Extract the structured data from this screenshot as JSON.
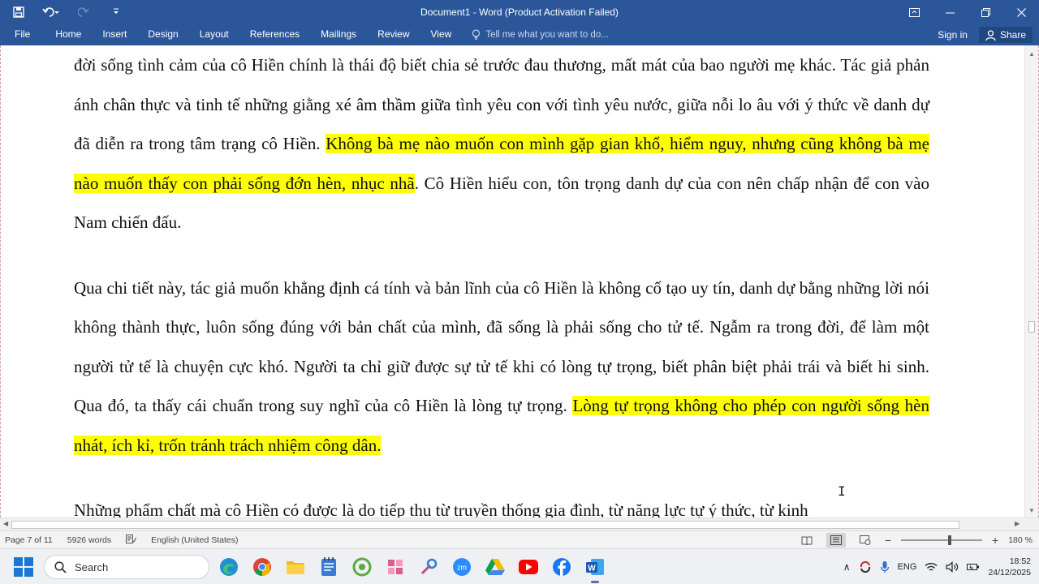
{
  "window": {
    "title": "Document1 - Word (Product Activation Failed)"
  },
  "ribbon": {
    "tabs": [
      "File",
      "Home",
      "Insert",
      "Design",
      "Layout",
      "References",
      "Mailings",
      "Review",
      "View"
    ],
    "tell_me_placeholder": "Tell me what you want to do...",
    "sign_in": "Sign in",
    "share": "Share"
  },
  "document": {
    "paragraphs": [
      {
        "segments": [
          {
            "text": "đời sống tình cảm của cô Hiền chính là thái độ biết chia sẻ trước đau thương, mất mát của bao người mẹ khác. Tác giả phản ánh chân thực và tinh tế những giằng xé âm thầm giữa tình yêu con với tình yêu nước, giữa nỗi lo âu với ý thức về danh dự đã diễn ra trong tâm trạng cô Hiền. ",
            "highlight": false
          },
          {
            "text": "Không bà mẹ nào muốn con mình gặp gian khổ, hiểm nguy, nhưng cũng không bà mẹ nào muốn thấy con phải sống đớn hèn, nhục nhã",
            "highlight": true
          },
          {
            "text": ". Cô Hiền hiểu con, tôn trọng danh dự của con nên chấp nhận để con vào Nam chiến đấu.",
            "highlight": false
          }
        ]
      },
      {
        "segments": [
          {
            "text": "Qua chi tiết này, tác giả muốn khẳng định cá tính và bản lĩnh của cô Hiền là không cố tạo uy tín, danh dự bằng những lời nói không thành thực, luôn sống đúng với bản chất của mình, đã sống là phải sống cho tử tế. Ngẫm ra trong đời, để làm một người tử tế là chuyện cực khó. Người ta chỉ giữ được sự tử tế khi có lòng tự trọng, biết phân biệt phải trái và biết hi sinh. Qua đó, ta thấy cái chuẩn trong suy nghĩ của cô Hiền là lòng tự trọng. ",
            "highlight": false
          },
          {
            "text": "Lòng tự trọng không cho phép con người sống hèn nhát, ích kỉ, trốn tránh trách nhiệm công dân.",
            "highlight": true
          }
        ]
      },
      {
        "segments": [
          {
            "text": "Những phẩm chất mà cô Hiền có được là do tiếp thu từ truyền thống gia đình, từ năng lực tự ý thức, từ kinh",
            "highlight": false
          }
        ]
      }
    ],
    "highlight_color": "#ffff00"
  },
  "status_bar": {
    "page": "Page 7 of 11",
    "words": "5926 words",
    "language": "English (United States)",
    "zoom": "180 %",
    "zoom_level_fraction": 0.6
  },
  "taskbar": {
    "search_placeholder": "Search",
    "language": "ENG",
    "time": "18:52",
    "date": "24/12/2025",
    "apps": [
      "edge-icon",
      "chrome-icon",
      "file-explorer-icon",
      "notepad-icon",
      "app-green-icon",
      "app-pink-icon",
      "app-tool-icon",
      "zoom-icon",
      "google-drive-icon",
      "youtube-icon",
      "facebook-icon",
      "word-icon"
    ]
  },
  "colors": {
    "ribbon_blue": "#2b579a",
    "highlight": "#ffff00"
  }
}
